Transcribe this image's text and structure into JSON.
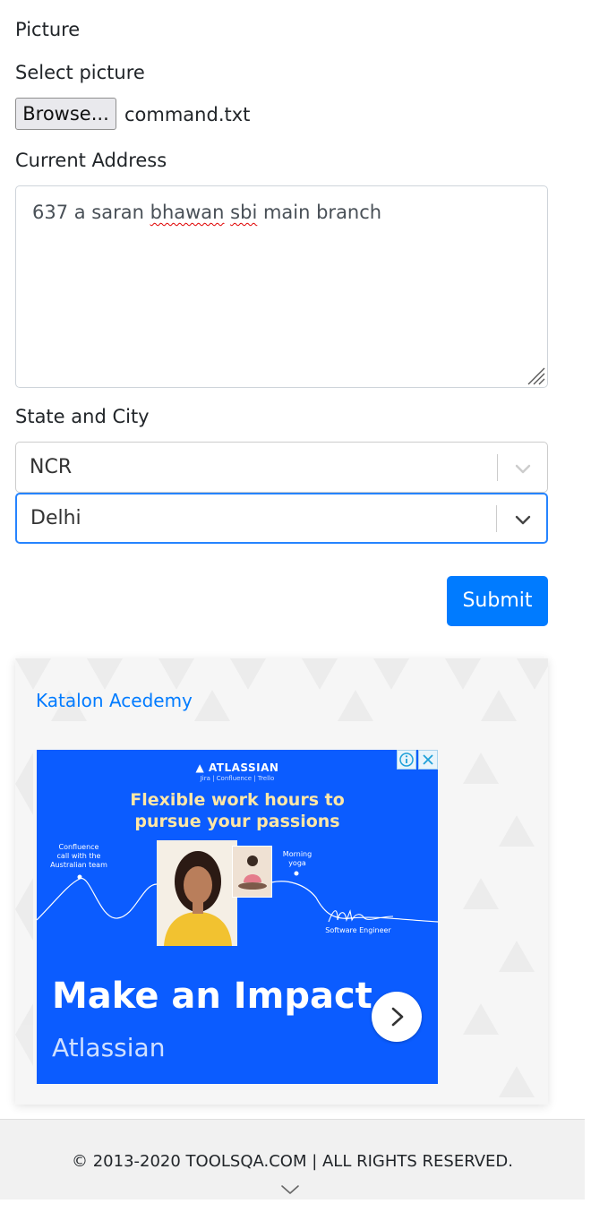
{
  "picture": {
    "section_label": "Picture",
    "select_label": "Select picture",
    "browse_label": "Browse...",
    "file_name": "command.txt"
  },
  "address": {
    "label": "Current Address",
    "value_parts": [
      "637 a saran ",
      "bhawan",
      " ",
      "sbi",
      " main branch"
    ]
  },
  "state_city": {
    "label": "State and City",
    "state_value": "NCR",
    "city_value": "Delhi"
  },
  "submit_label": "Submit",
  "ad": {
    "link_text": "Katalon Acedemy",
    "brand": "▲ ATLASSIAN",
    "products": "Jira | Confluence | Trello",
    "headline_line1": "Flexible work hours to",
    "headline_line2": "pursue your passions",
    "note_left_1": "Confluence",
    "note_left_2": "call with the",
    "note_left_3": "Australian team",
    "note_right_1": "Morning",
    "note_right_2": "yoga",
    "signature_role": "Software Engineer",
    "title": "Make an Impact",
    "company": "Atlassian",
    "colors": {
      "banner_bg": "#0b5cff",
      "headline": "#ffe7a6"
    }
  },
  "footer": {
    "copyright": "© 2013-2020 TOOLSQA.COM | ALL RIGHTS RESERVED."
  },
  "colors": {
    "primary": "#007bff",
    "focus_border": "#2684ff"
  }
}
